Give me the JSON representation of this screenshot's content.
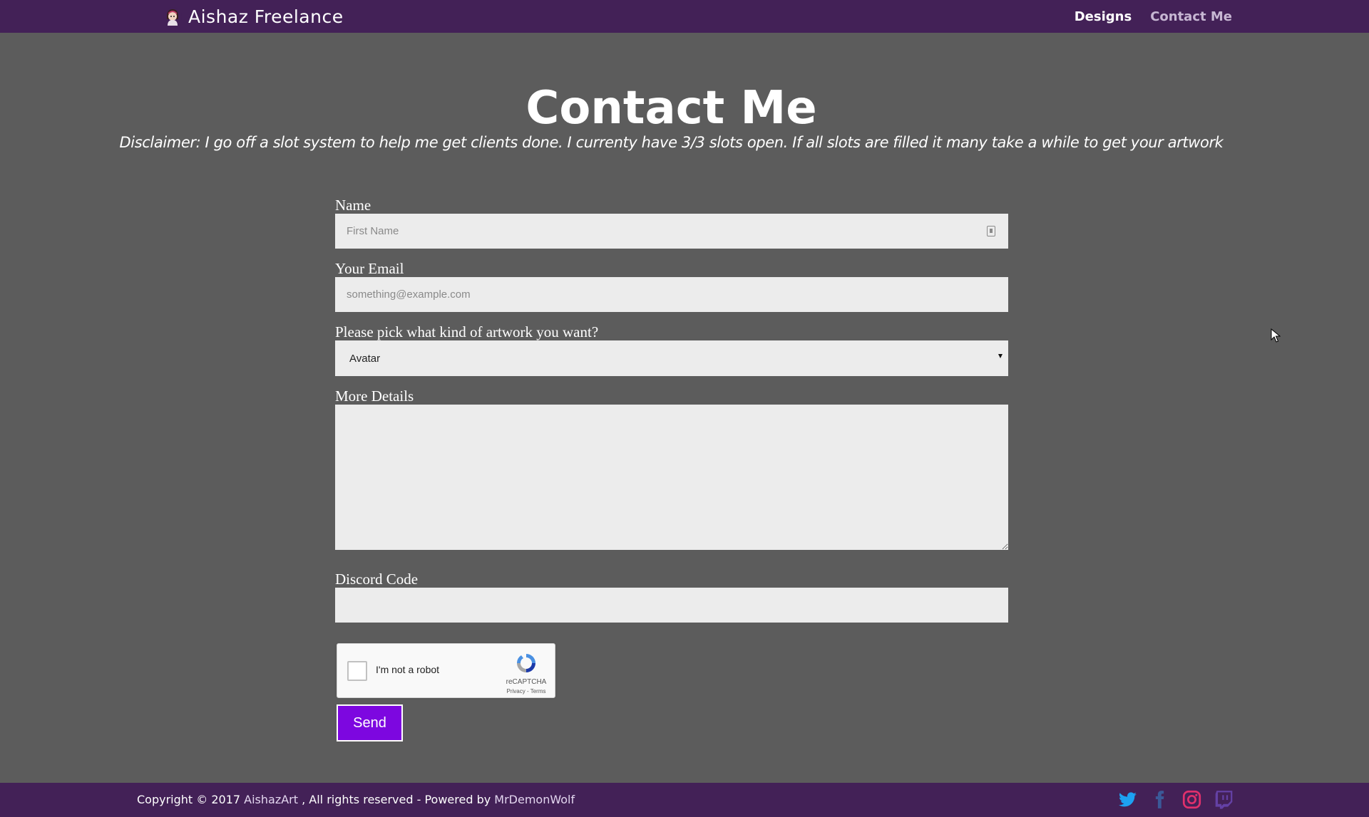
{
  "header": {
    "brand": "Aishaz Freelance",
    "nav": [
      {
        "label": "Designs"
      },
      {
        "label": "Contact Me"
      }
    ]
  },
  "main": {
    "title": "Contact Me",
    "disclaimer": "Disclaimer:  I go off a slot system to help me get clients done.  I currenty have 3/3 slots open.  If all slots are filled it many take a while to get your artwork"
  },
  "form": {
    "name": {
      "label": "Name",
      "placeholder": "First Name"
    },
    "email": {
      "label": "Your Email",
      "placeholder": "something@example.com"
    },
    "artwork": {
      "label": "Please pick what kind of artwork you want?",
      "selected": "Avatar"
    },
    "details": {
      "label": "More Details"
    },
    "discord": {
      "label": "Discord Code"
    },
    "captcha": {
      "label": "I'm not a robot",
      "brand": "reCAPTCHA",
      "terms": "Privacy - Terms"
    },
    "send_label": "Send"
  },
  "footer": {
    "copyright_prefix": "Copyright © 2017 ",
    "author": "AishazArt",
    "middle": " , All rights reserved - Powered by ",
    "powered_by": "MrDemonWolf",
    "social": [
      "twitter-icon",
      "facebook-icon",
      "instagram-icon",
      "twitch-icon"
    ]
  },
  "colors": {
    "header_bg": "#432157",
    "page_bg": "#5c5c5c",
    "accent_button": "#7d07e0",
    "field_bg": "#ececec"
  }
}
